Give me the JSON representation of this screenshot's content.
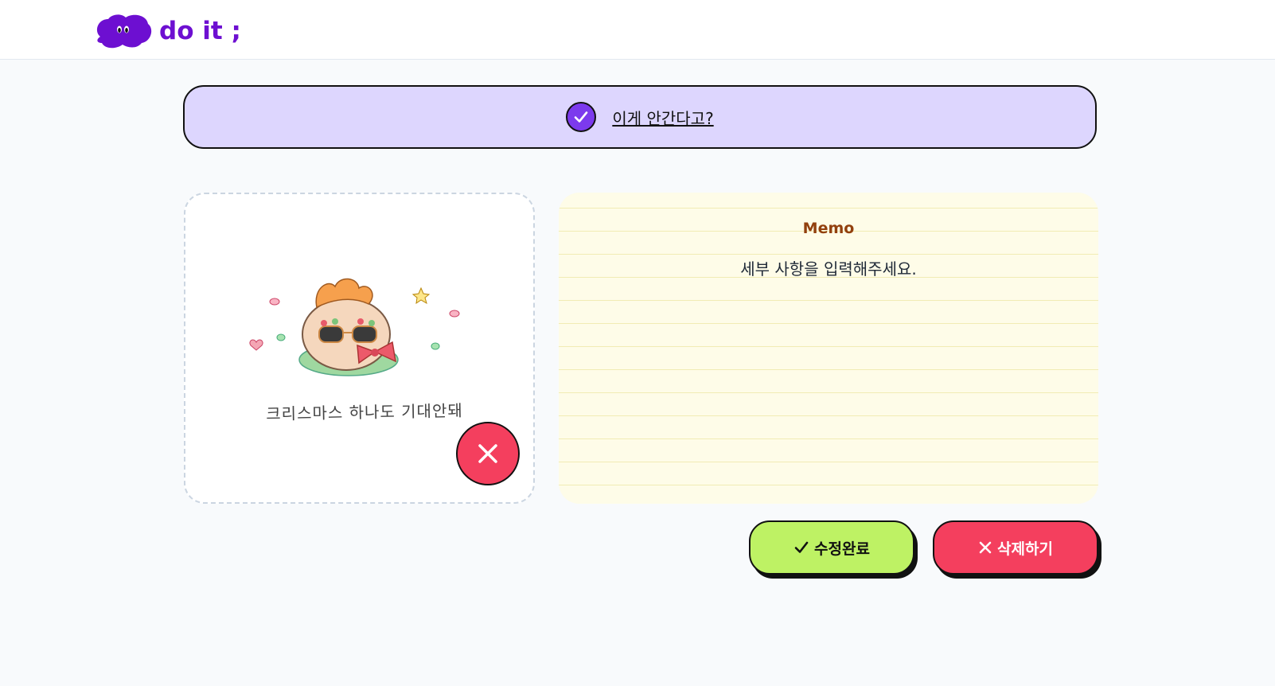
{
  "header": {
    "logo_text": "do it ;",
    "logo_color": "#6d0fd1"
  },
  "todo": {
    "name": "이게 안간다고?",
    "completed": true,
    "bar_color": "#ddd6fe",
    "check_color": "#7c3aed"
  },
  "image": {
    "caption": "크리스마스 하나도 기대안돼",
    "delete_icon": "close-icon",
    "delete_color": "#f43f5e"
  },
  "memo": {
    "title": "Memo",
    "placeholder": "세부 사항을 입력해주세요."
  },
  "actions": {
    "edit_label": "수정완료",
    "edit_icon": "check-icon",
    "edit_color": "#bef264",
    "delete_label": "삭제하기",
    "delete_icon": "close-icon",
    "delete_color": "#f43f5e"
  }
}
